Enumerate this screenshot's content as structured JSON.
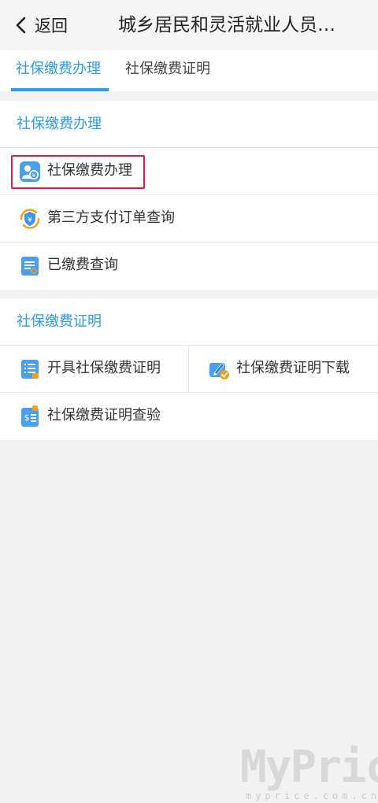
{
  "header": {
    "back_label": "返回",
    "title": "城乡居民和灵活就业人员…"
  },
  "tabs": [
    {
      "label": "社保缴费办理"
    },
    {
      "label": "社保缴费证明"
    }
  ],
  "section1": {
    "title": "社保缴费办理",
    "items": [
      {
        "label": "社保缴费办理",
        "icon": "payment-person-icon"
      },
      {
        "label": "第三方支付订单查询",
        "icon": "shield-yen-icon"
      },
      {
        "label": "已缴费查询",
        "icon": "document-search-icon"
      }
    ]
  },
  "section2": {
    "title": "社保缴费证明",
    "items": [
      {
        "label": "开具社保缴费证明",
        "icon": "list-document-icon"
      },
      {
        "label": "社保缴费证明下载",
        "icon": "edit-download-icon"
      },
      {
        "label": "社保缴费证明查验",
        "icon": "dollar-document-icon"
      }
    ]
  },
  "watermark": {
    "brand": "MyPrice",
    "url": "myprice.com.cn"
  },
  "colors": {
    "accent": "#2d9be8",
    "highlight": "#d0213d"
  }
}
